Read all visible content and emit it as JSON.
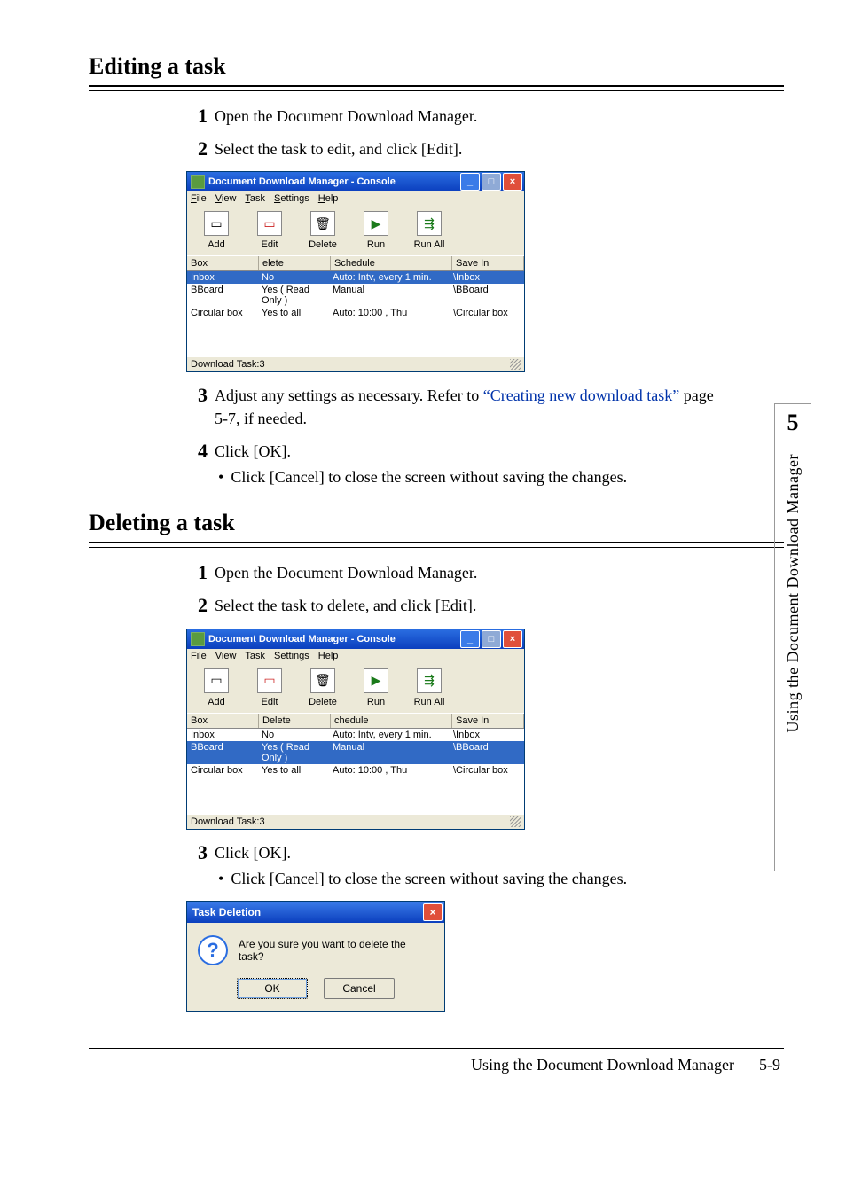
{
  "chapter_tab": {
    "number": "5",
    "title": "Using the Document Download Manager"
  },
  "section1": {
    "title": "Editing a task",
    "steps": {
      "s1": {
        "num": "1",
        "text": "Open the Document Download Manager."
      },
      "s2": {
        "num": "2",
        "text": "Select the task to edit, and click [Edit]."
      },
      "s3": {
        "num": "3",
        "prefix": "Adjust any settings as necessary. Refer to ",
        "link": "“Creating new download task”",
        "suffix": " page 5-7, if needed."
      },
      "s4": {
        "num": "4",
        "text": "Click [OK].",
        "bullet": "Click [Cancel] to close the screen without saving the changes."
      }
    }
  },
  "section2": {
    "title": "Deleting a task",
    "steps": {
      "s1": {
        "num": "1",
        "text": "Open the Document Download Manager."
      },
      "s2": {
        "num": "2",
        "text": "Select the task to delete, and click [Edit]."
      },
      "s3": {
        "num": "3",
        "text": "Click [OK].",
        "bullet": "Click [Cancel] to close the screen without saving the changes."
      }
    }
  },
  "app_window": {
    "title": "Document Download Manager - Console",
    "menus": {
      "file": "File",
      "view": "View",
      "task": "Task",
      "settings": "Settings",
      "help": "Help"
    },
    "toolbar": {
      "add": "Add",
      "edit": "Edit",
      "delete": "Delete",
      "run": "Run",
      "runall": "Run All"
    },
    "columns": {
      "box": "Box",
      "delete": "Delete",
      "schedule": "Schedule",
      "savein": "Save In"
    },
    "cols_alt": {
      "delete": "elete",
      "schedule": "chedule"
    },
    "rows": [
      {
        "box": "Inbox",
        "del": "No",
        "sched": "Auto: Intv, every 1 min.",
        "save": "\\Inbox"
      },
      {
        "box": "BBoard",
        "del": "Yes ( Read Only )",
        "sched": "Manual",
        "save": "\\BBoard"
      },
      {
        "box": "Circular box",
        "del": "Yes to all",
        "sched": "Auto: 10:00 , Thu",
        "save": "\\Circular box"
      }
    ],
    "status": "Download Task:3",
    "cursor_label_edit": "Edit"
  },
  "dialog": {
    "title": "Task Deletion",
    "message": "Are you sure you want to delete the task?",
    "ok": "OK",
    "cancel": "Cancel"
  },
  "footer": {
    "chapter_title": "Using the Document Download Manager",
    "page_num": "5-9"
  }
}
